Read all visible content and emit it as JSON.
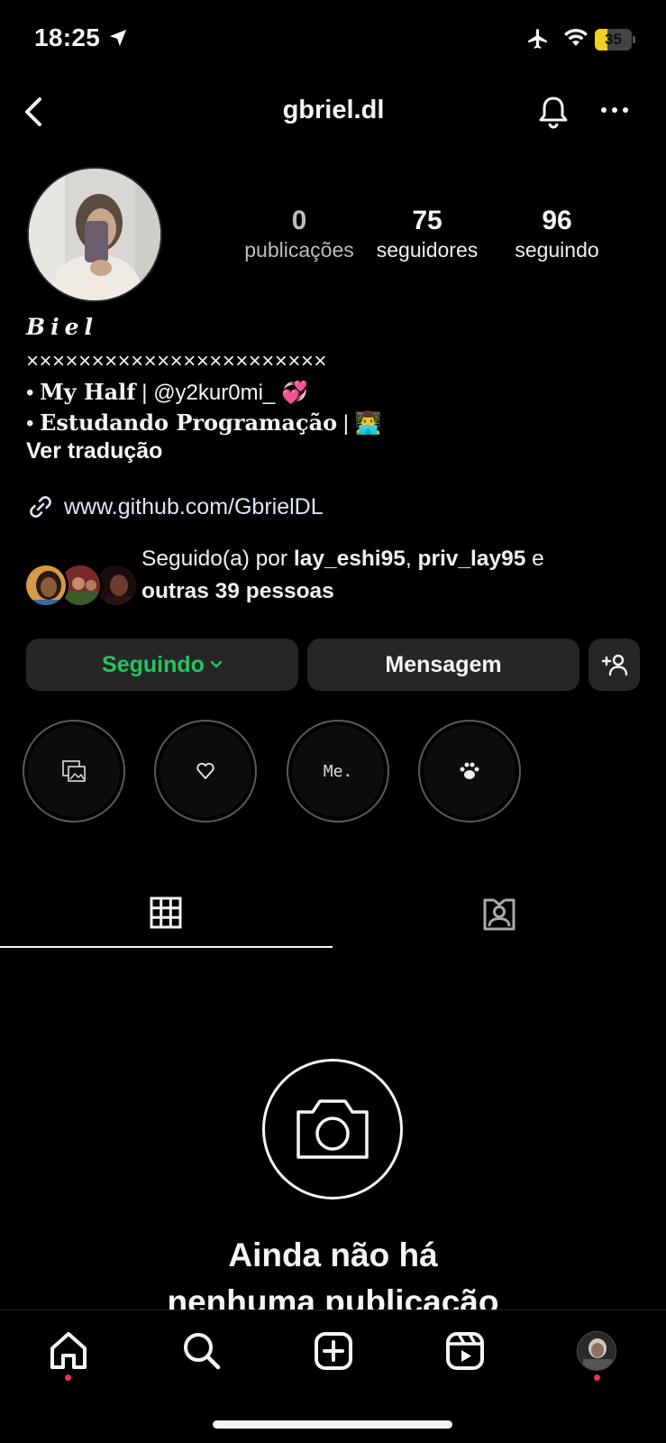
{
  "status_bar": {
    "time": "18:25",
    "battery": "35",
    "battery_level": 0.35,
    "battery_color": "#f5d020"
  },
  "header": {
    "username": "gbriel.dl",
    "back_icon": "chevron-left-icon",
    "bell_icon": "bell-icon",
    "more_icon": "more-horizontal-icon"
  },
  "stats": {
    "posts_count": "0",
    "posts_label": "publicações",
    "followers_count": "75",
    "followers_label": "seguidores",
    "following_count": "96",
    "following_label": "seguindo"
  },
  "bio": {
    "name": "Biel",
    "divider": "×××××××××××××××××××××××",
    "line1_prefix": "• ",
    "line1_title": "My Half",
    "line1_rest": " | @y2kur0mi_ ",
    "line1_emoji": "💞",
    "line2_prefix": "• ",
    "line2_title": "Estudando Programação",
    "line2_rest": " | ",
    "line2_emoji": "👨‍💻",
    "translate": "Ver tradução",
    "link": "www.github.com/GbrielDL"
  },
  "followed_by": {
    "prefix": "Seguido(a) por ",
    "user1": "lay_eshi95",
    "sep": ", ",
    "user2": "priv_lay95",
    "and": " e",
    "others": "outras 39 pessoas"
  },
  "buttons": {
    "following": "Seguindo",
    "message": "Mensagem",
    "following_color": "#22c55e"
  },
  "highlights": [
    {
      "icon": "photos-icon"
    },
    {
      "icon": "heart-icon"
    },
    {
      "label": "Me."
    },
    {
      "icon": "paw-icon"
    }
  ],
  "tabs": {
    "grid_icon": "grid-icon",
    "tagged_icon": "tagged-person-icon"
  },
  "empty_state": {
    "line1": "Ainda não há",
    "line2": "nenhuma publicação"
  },
  "nav": {
    "items": [
      "home-icon",
      "search-icon",
      "add-post-icon",
      "reels-icon",
      "profile-avatar"
    ],
    "dot_color": "#ff2d55"
  }
}
